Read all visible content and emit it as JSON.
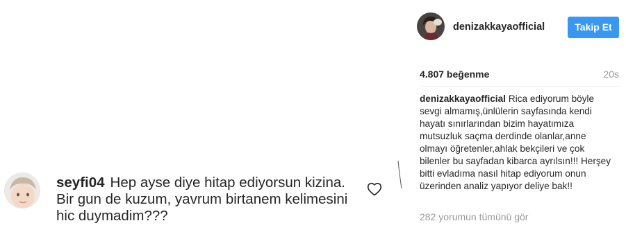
{
  "post": {
    "username": "denizakkayaofficial",
    "follow_label": "Takip Et",
    "likes": "4.807 beğenme",
    "time_ago": "20s",
    "caption": {
      "username": "denizakkayaofficial",
      "text": "Rica ediyorum böyle sevgi almamış,ünlülerin sayfasında kendi hayatı sınırlarından bizim hayatımıza mutsuzluk saçma derdinde olanlar,anne olmayı öğretenler,ahlak bekçileri ve çok bilenler bu sayfadan kibarca ayrılsın!!! Herşey bitti evladıma nasıl hitap ediyorum onun üzerinden analiz yapıyor deliye bak!!"
    },
    "view_all_comments": "282 yorumun tümünü gör"
  },
  "comment": {
    "username": "seyfi04",
    "text": "Hep ayse diye hitap ediyorsun kizina. Bir gun de kuzum, yavrum birtanem kelimesini hic duymadim???"
  },
  "icons": {
    "comment_like": "heart-outline-icon"
  },
  "colors": {
    "accent": "#3897f0",
    "muted_text": "#999999",
    "text": "#262626"
  }
}
